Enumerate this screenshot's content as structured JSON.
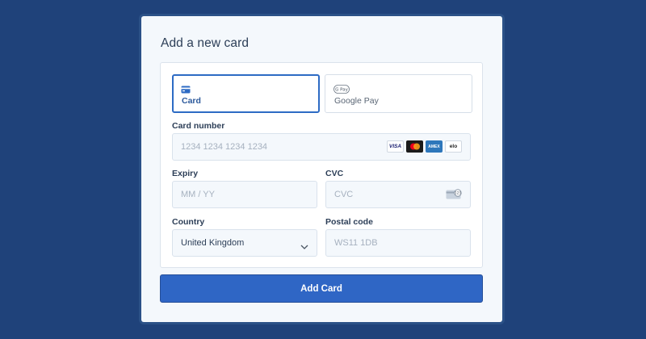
{
  "title": "Add a new card",
  "methods": [
    {
      "label": "Card",
      "icon": "credit-card-icon",
      "active": true
    },
    {
      "label": "Google Pay",
      "icon": "google-pay-icon",
      "active": false
    }
  ],
  "card_number": {
    "label": "Card number",
    "placeholder": "1234 1234 1234 1234"
  },
  "card_brands": [
    "VISA",
    "mastercard",
    "AMEX",
    "elo"
  ],
  "expiry": {
    "label": "Expiry",
    "placeholder": "MM / YY"
  },
  "cvc": {
    "label": "CVC",
    "placeholder": "CVC",
    "icon_text": "123"
  },
  "country": {
    "label": "Country",
    "value": "United Kingdom"
  },
  "postal": {
    "label": "Postal code",
    "placeholder": "WS11 1DB"
  },
  "submit_label": "Add Card",
  "colors": {
    "background": "#1f427a",
    "accent": "#2f66c5",
    "panel": "#f4f8fc"
  }
}
